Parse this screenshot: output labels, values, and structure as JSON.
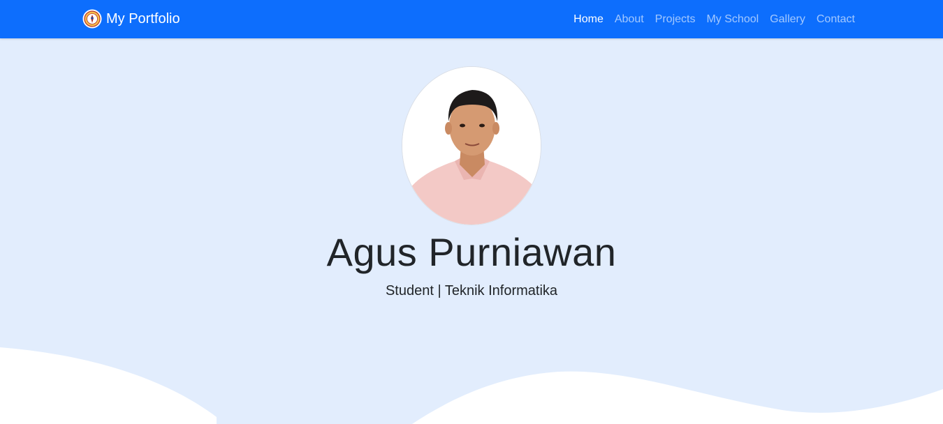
{
  "navbar": {
    "brand": "My Portfolio",
    "links": [
      {
        "label": "Home",
        "active": true
      },
      {
        "label": "About",
        "active": false
      },
      {
        "label": "Projects",
        "active": false
      },
      {
        "label": "My School",
        "active": false
      },
      {
        "label": "Gallery",
        "active": false
      },
      {
        "label": "Contact",
        "active": false
      }
    ]
  },
  "hero": {
    "name": "Agus Purniawan",
    "subtitle": "Student | Teknik Informatika"
  },
  "colors": {
    "navbar_bg": "#0d6efd",
    "hero_bg": "#e2edfd",
    "wave": "#ffffff",
    "text": "#212529"
  }
}
